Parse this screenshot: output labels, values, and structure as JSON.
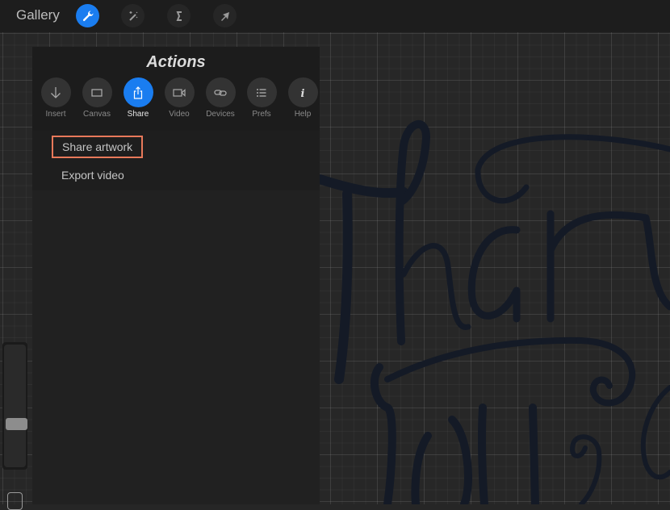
{
  "topbar": {
    "gallery_label": "Gallery",
    "tools": [
      {
        "name": "actions",
        "icon": "wrench-icon",
        "active": true
      },
      {
        "name": "adjustments",
        "icon": "magic-wand-icon",
        "active": false
      },
      {
        "name": "selection",
        "icon": "selection-s-icon",
        "active": false
      },
      {
        "name": "transform",
        "icon": "arrow-cursor-icon",
        "active": false
      }
    ]
  },
  "actions": {
    "title": "Actions",
    "tabs": [
      {
        "label": "Insert",
        "icon": "arrow-down-icon",
        "active": false
      },
      {
        "label": "Canvas",
        "icon": "rectangle-icon",
        "active": false
      },
      {
        "label": "Share",
        "icon": "share-icon",
        "active": true
      },
      {
        "label": "Video",
        "icon": "video-camera-icon",
        "active": false
      },
      {
        "label": "Devices",
        "icon": "link-icon",
        "active": false
      },
      {
        "label": "Prefs",
        "icon": "list-icon",
        "active": false
      },
      {
        "label": "Help",
        "icon": "info-icon",
        "active": false
      }
    ],
    "menu": [
      {
        "label": "Share artwork",
        "highlighted": true
      },
      {
        "label": "Export video",
        "highlighted": false
      }
    ]
  },
  "canvas": {
    "artwork_text": "Thank You"
  },
  "colors": {
    "accent": "#1a7df0",
    "highlight_border": "#e8795a",
    "ink": "#141a26"
  }
}
